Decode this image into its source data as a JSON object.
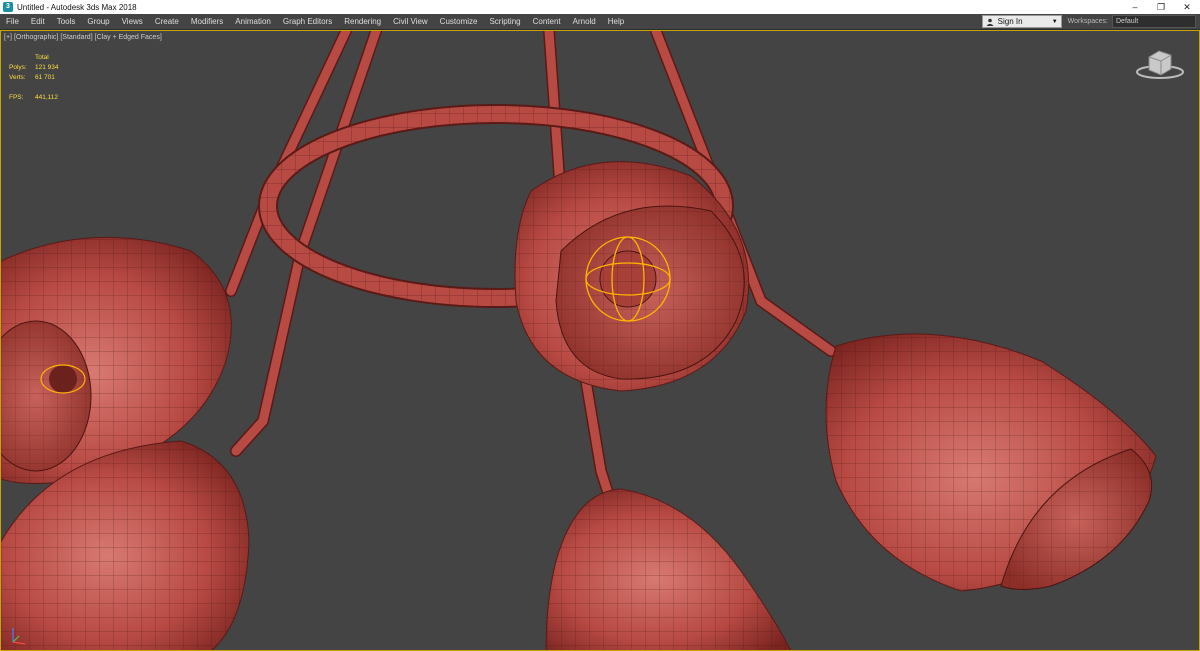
{
  "window": {
    "title": "Untitled - Autodesk 3ds Max 2018",
    "app_icon": "3ds-max-icon",
    "controls": [
      "–",
      "❐",
      "✕"
    ]
  },
  "menu": {
    "items": [
      "File",
      "Edit",
      "Tools",
      "Group",
      "Views",
      "Create",
      "Modifiers",
      "Animation",
      "Graph Editors",
      "Rendering",
      "Civil View",
      "Customize",
      "Scripting",
      "Content",
      "Arnold",
      "Help"
    ],
    "sign_in": "Sign In",
    "workspaces_label": "Workspaces:",
    "workspace": "Default"
  },
  "viewport": {
    "labels": [
      "[+]",
      "[Orthographic]",
      "[Standard]",
      "[Clay + Edged Faces]"
    ],
    "stats": {
      "header": "Total",
      "polys_label": "Polys:",
      "polys": "121 934",
      "verts_label": "Verts:",
      "verts": "61 701",
      "fps_label": "FPS:",
      "fps": "441,112"
    },
    "model_color": "#b84a44",
    "selection_color": "#ffb400",
    "border_color": "#c8a600",
    "background_color": "#444444"
  }
}
